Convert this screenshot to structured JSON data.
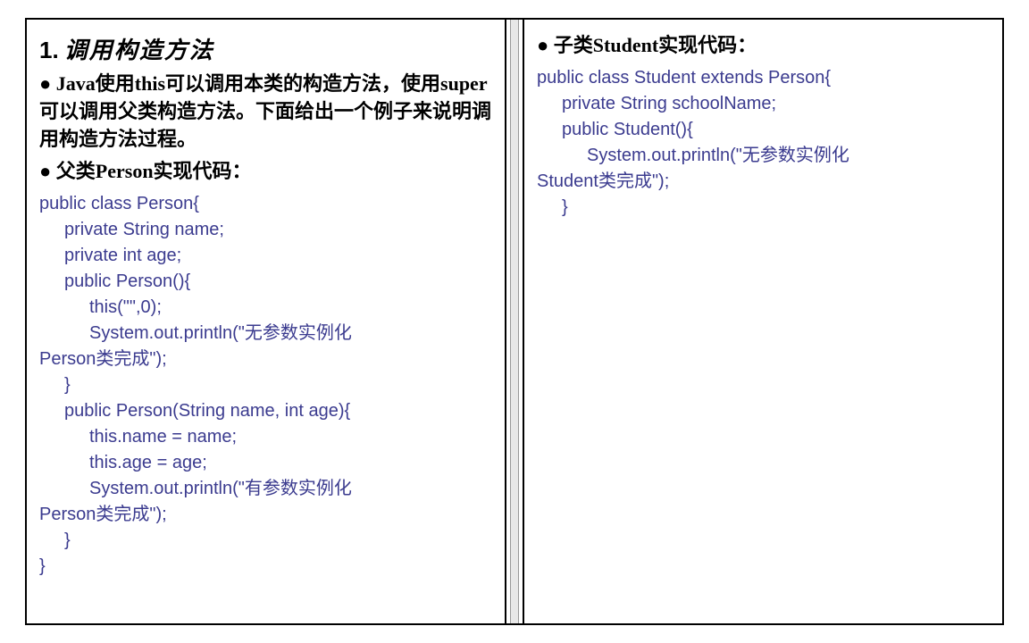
{
  "left": {
    "num": "1.",
    "heading": "调用构造方法",
    "para1": "● Java使用this可以调用本类的构造方法，使用super可以调用父类构造方法。下面给出一个例子来说明调用构造方法过程。",
    "para2": "● 父类Person实现代码：",
    "code": {
      "l1": "public class Person{",
      "l2": "private String name;",
      "l3": "private int age;",
      "l4": "public Person(){",
      "l5": "this(\"\",0);",
      "l6a": "System.out.println(\"",
      "l6b": "无参数实例化",
      "l7a": "Person",
      "l7b": "类完成",
      "l7c": "\");",
      "l8": "}",
      "l9": "public Person(String name, int age){",
      "l10": "this.name = name;",
      "l11": "this.age = age;",
      "l12a": "System.out.println(\"",
      "l12b": "有参数实例化",
      "l13a": "Person",
      "l13b": "类完成",
      "l13c": "\");",
      "l14": "}",
      "l15": "}"
    }
  },
  "right": {
    "para1": "● 子类Student实现代码：",
    "code": {
      "l1": "public class Student extends Person{",
      "l2": "private String schoolName;",
      "l3": "public Student(){",
      "l4a": "System.out.println(\"",
      "l4b": "无参数实例化",
      "l5a": "Student",
      "l5b": "类完成",
      "l5c": "\");",
      "l6": "}"
    }
  }
}
